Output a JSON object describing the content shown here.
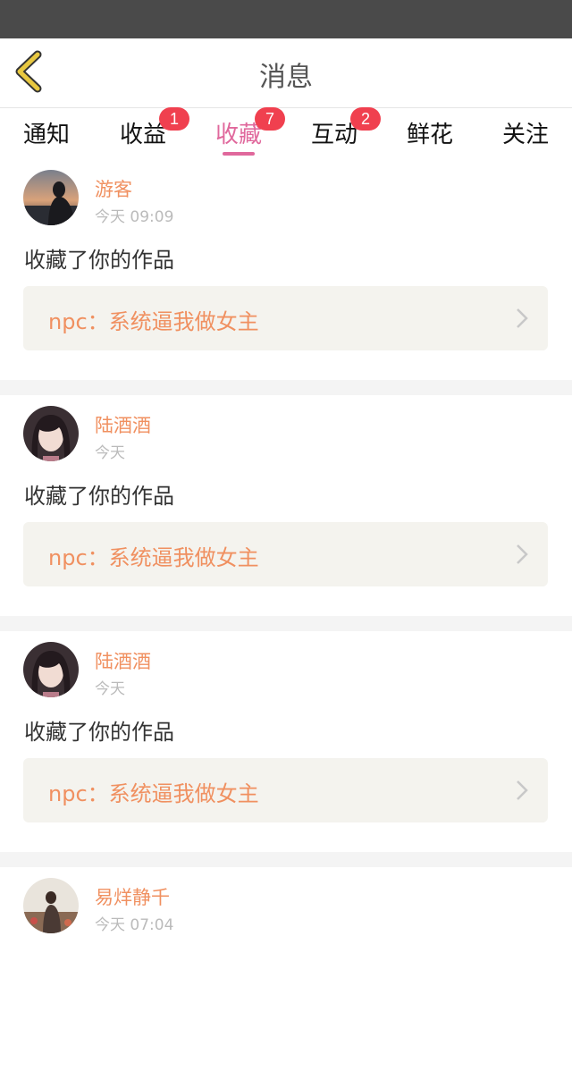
{
  "header": {
    "title": "消息"
  },
  "tabs": [
    {
      "label": "通知",
      "badge": ""
    },
    {
      "label": "收益",
      "badge": "1"
    },
    {
      "label": "收藏",
      "badge": "7",
      "active": true
    },
    {
      "label": "互动",
      "badge": "2"
    },
    {
      "label": "鲜花",
      "badge": ""
    },
    {
      "label": "关注",
      "badge": ""
    }
  ],
  "colors": {
    "accent": "#e0689c",
    "username": "#f09060",
    "badge": "#f0404f",
    "back_icon": "#e8c840"
  },
  "feed": [
    {
      "user": "游客",
      "time": "今天 09:09",
      "action": "收藏了你的作品",
      "work": "npc：系统逼我做女主",
      "avatar": "avatar-sunset-silhouette"
    },
    {
      "user": "陆酒酒",
      "time": "今天",
      "action": "收藏了你的作品",
      "work": "npc：系统逼我做女主",
      "avatar": "avatar-girl-portrait"
    },
    {
      "user": "陆酒酒",
      "time": "今天",
      "action": "收藏了你的作品",
      "work": "npc：系统逼我做女主",
      "avatar": "avatar-girl-portrait"
    },
    {
      "user": "易烊静千",
      "time": "今天 07:04",
      "action": "",
      "work": "",
      "avatar": "avatar-field-photo"
    }
  ]
}
